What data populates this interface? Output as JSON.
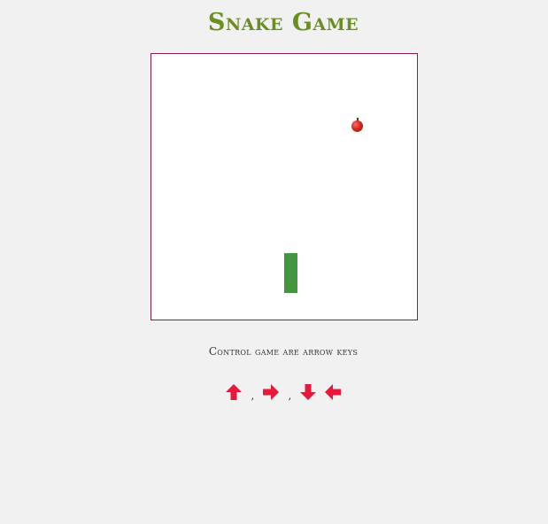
{
  "title": "Snake Game",
  "colors": {
    "title": "#6b8e23",
    "snake": "#42963e",
    "board_border": "#8b1a4a",
    "arrow": "#e8173b",
    "background": "#f1f1f1"
  },
  "board": {
    "apple": "apple-icon",
    "snake_length_segments": 3
  },
  "controls": {
    "label": "Control game are arrow keys",
    "separator_1": ",",
    "separator_2": ",",
    "keys": [
      "arrow-up-icon",
      "arrow-right-icon",
      "arrow-down-icon",
      "arrow-left-icon"
    ]
  }
}
